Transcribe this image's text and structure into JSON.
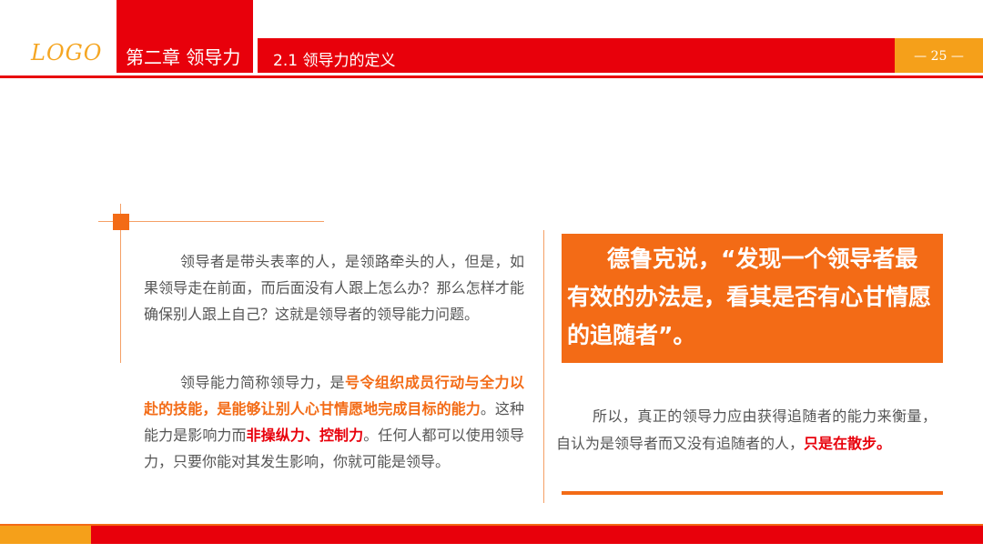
{
  "header": {
    "logo": "LOGO",
    "chapter": "第二章 领导力",
    "section": "2.1 领导力的定义",
    "page": "— 25 —"
  },
  "left": {
    "para1": "领导者是带头表率的人，是领路牵头的人，但是，如果领导走在前面，而后面没有人跟上怎么办？那么怎样才能确保别人跟上自己？这就是领导者的领导能力问题。",
    "para2": {
      "t1": "领导能力简称领导力，是",
      "h1": "号令组织成员行动与全力以赴的技能，是能够让别人心甘情愿地完成目标的能力",
      "t2": "。这种能力是影响力而",
      "h2": "非操纵力、控制力",
      "t3": "。任何人都可以使用领导力，只要你能对其发生影响，你就可能是领导。"
    }
  },
  "right": {
    "quote": "德鲁克说，“发现一个领导者最有效的办法是，看其是否有心甘情愿的追随者”。",
    "para3": {
      "t1": "所以，真正的领导力应由获得追随者的能力来衡量，自认为是领导者而又没有追随者的人，",
      "h1": "只是在散步。"
    }
  },
  "colors": {
    "red": "#e8000b",
    "orange": "#f36b16",
    "amber": "#f5a01a"
  }
}
